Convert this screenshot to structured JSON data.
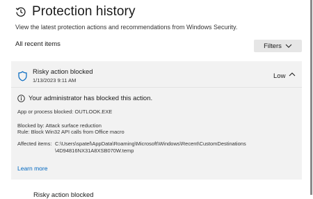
{
  "header": {
    "title": "Protection history",
    "subtitle": "View the latest protection actions and recommendations from Windows Security.",
    "icon": "history-clock-icon"
  },
  "list": {
    "label": "All recent items",
    "filters_label": "Filters"
  },
  "item": {
    "title": "Risky action blocked",
    "date": "1/13/2023 9:11 AM",
    "severity": "Low",
    "notice": "Your administrator has blocked this action.",
    "app_line": "App or process blocked: OUTLOOK.EXE",
    "blocked_by": "Blocked by:  Attack surface reduction",
    "rule": "Rule:  Block Win32 API calls from Office macro",
    "affected_label": "Affected items:",
    "affected_path_1": "C:\\Users\\spatel\\AppData\\Roaming\\Microsoft\\Windows\\Recent\\CustomDestinations",
    "affected_path_2": "\\4D94816NX31A8XSB070W.temp",
    "learn_more": "Learn more"
  },
  "next_item": {
    "title": "Risky action blocked"
  },
  "colors": {
    "accent": "#0067c0",
    "card_bg": "#f2f2f2",
    "button_bg": "#e6e6e6",
    "shield": "#0067c0"
  }
}
